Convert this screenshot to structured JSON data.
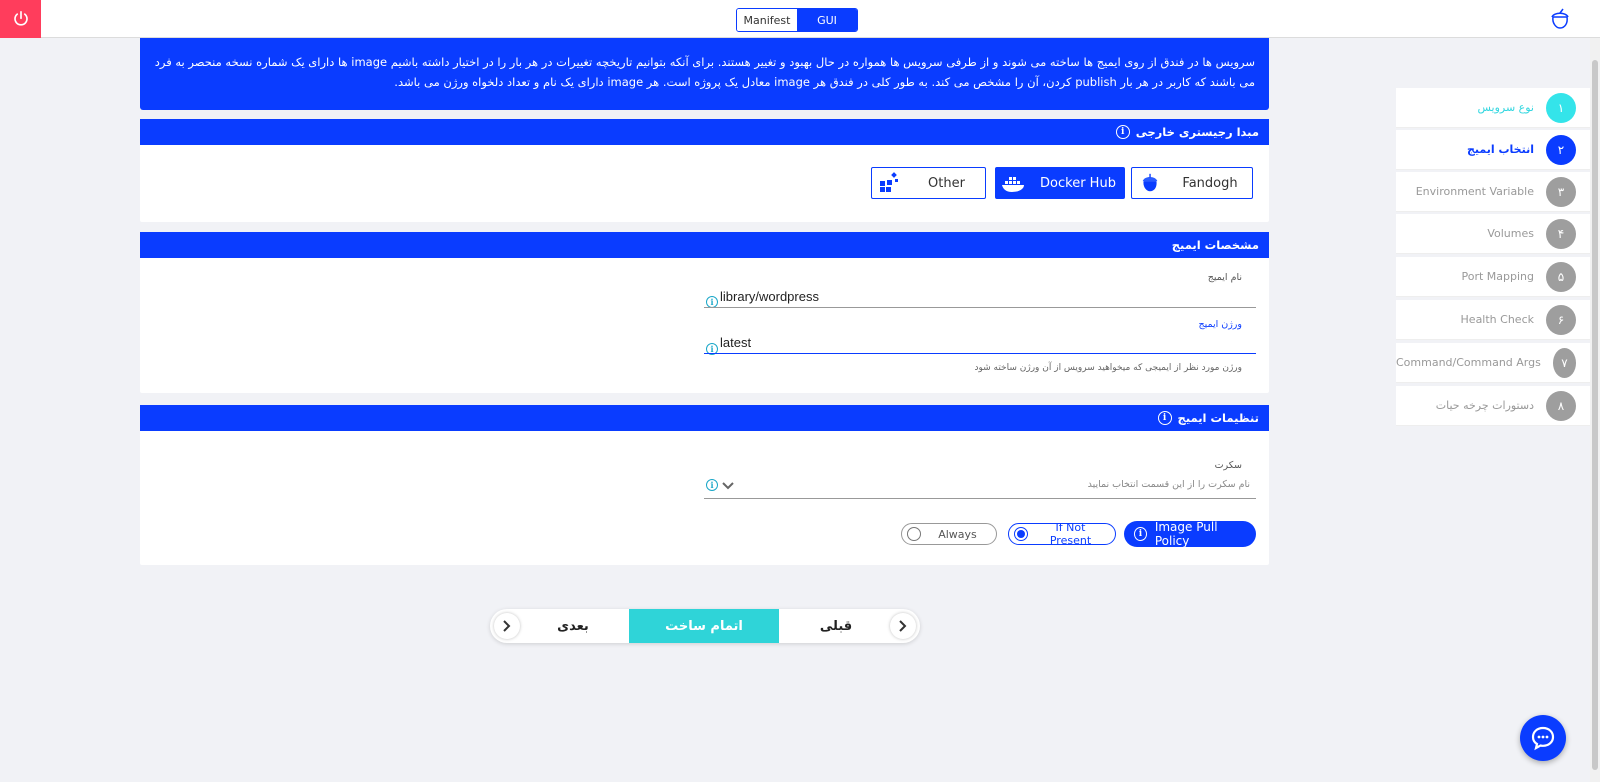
{
  "topbar": {
    "power_icon": "power-icon",
    "mode_manifest": "Manifest",
    "mode_gui": "GUI",
    "logo_icon": "fandogh-logo-icon"
  },
  "banner": {
    "text": "سرویس ها در فندق از روی ایمیج ها ساخته می شوند و از طرفی سرویس ها همواره در حال بهبود و تغییر هستند. برای آنکه بتوانیم تاریخچه تغییرات در هر بار را در اختیار داشته باشیم image ها دارای یک شماره نسخه منحصر به فرد می باشند که کاربر در هر بار publish کردن، آن را مشخص می کند. به طور کلی در فندق هر image معادل یک پروژه است. هر image دارای یک نام و تعداد دلخواه ورژن می باشد."
  },
  "registry": {
    "title": "مبدا رجیستری خارجی",
    "options": [
      {
        "label": "Fandogh",
        "icon": "fandogh-icon"
      },
      {
        "label": "Docker Hub",
        "icon": "docker-icon"
      },
      {
        "label": "Other",
        "icon": "other-registry-icon"
      }
    ],
    "selected": "Docker Hub"
  },
  "image_spec": {
    "title": "مشخصات ایمیج",
    "name_label": "نام ایمیج",
    "name_value": "library/wordpress",
    "version_label": "ورژن ایمیج",
    "version_value": "latest",
    "version_hint": "ورژن مورد نظر از ایمیجی که میخواهید سرویس از آن ورژن ساخته شود"
  },
  "image_settings": {
    "title": "تنظیمات ایمیج",
    "secret_label": "سکرت",
    "secret_placeholder": "نام سکرت را از این قسمت انتخاب نمایید",
    "pull_policy_label": "Image Pull Policy",
    "options": [
      "If Not Present",
      "Always"
    ],
    "selected": "If Not Present"
  },
  "steps": [
    {
      "num": "۱",
      "label": "نوع سرویس",
      "state": "done"
    },
    {
      "num": "۲",
      "label": "انتخاب ایمیج",
      "state": "current"
    },
    {
      "num": "۳",
      "label": "Environment Variable",
      "state": "pending"
    },
    {
      "num": "۴",
      "label": "Volumes",
      "state": "pending"
    },
    {
      "num": "۵",
      "label": "Port Mapping",
      "state": "pending"
    },
    {
      "num": "۶",
      "label": "Health Check",
      "state": "pending"
    },
    {
      "num": "۷",
      "label": "Command/Command Args",
      "state": "pending"
    },
    {
      "num": "۸",
      "label": "دستورات چرخه حیات",
      "state": "pending"
    }
  ],
  "nav": {
    "next": "بعدی",
    "finish": "اتمام ساخت",
    "prev": "قبلی"
  },
  "colors": {
    "primary": "#0a3cff",
    "accent": "#2fd4d8",
    "power": "#ff3d5c"
  }
}
